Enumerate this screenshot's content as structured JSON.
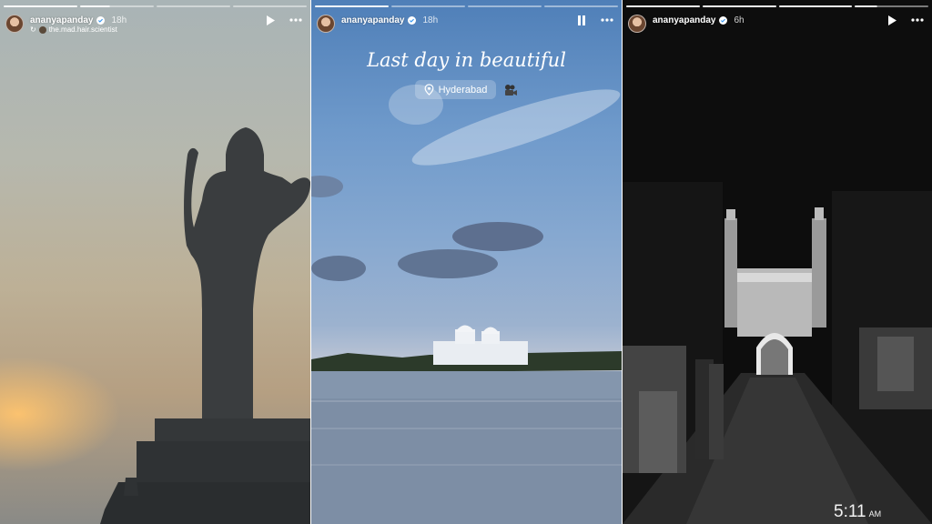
{
  "stories": [
    {
      "username": "ananyapanday",
      "time": "18h",
      "reshared_from": "the.mad.hair.scientist",
      "playback_state": "play-icon",
      "progress": [
        1,
        0.4,
        0,
        0
      ]
    },
    {
      "username": "ananyapanday",
      "time": "18h",
      "playback_state": "pause-icon",
      "caption": "Last day in beautiful",
      "location": "Hyderabad",
      "progress": [
        1,
        0,
        0,
        0
      ]
    },
    {
      "username": "ananyapanday",
      "time": "6h",
      "playback_state": "play-icon",
      "clock_time": "5:11",
      "clock_ampm": "AM",
      "progress": [
        1,
        1,
        1,
        0.3
      ]
    }
  ],
  "colors": {
    "verified_badge": "#3897f0",
    "text": "#ffffff"
  }
}
